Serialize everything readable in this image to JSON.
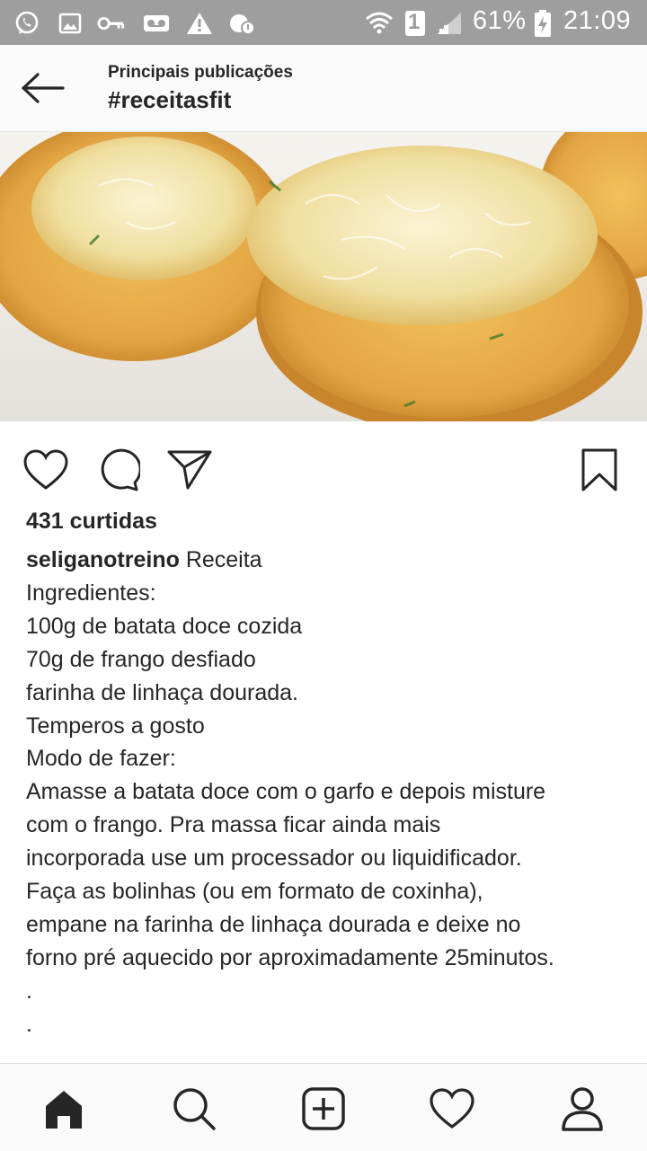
{
  "status_bar": {
    "battery": "61%",
    "time": "21:09",
    "sim_slot": "1",
    "icons": [
      "whatsapp-icon",
      "image-icon",
      "key-icon",
      "voicemail-icon",
      "warning-icon",
      "weather-icon",
      "wifi-icon",
      "sim-icon",
      "signal-icon",
      "battery-charging-icon"
    ]
  },
  "header": {
    "subtitle": "Principais publicações",
    "title": "#receitasfit"
  },
  "post": {
    "likes": "431 curtidas",
    "username": "seliganotreino",
    "caption_first": " Receita",
    "caption_lines": [
      "Ingredientes:",
      "100g de batata doce cozida",
      "70g de frango desfiado",
      "farinha de linhaça dourada.",
      "Temperos a gosto",
      "Modo de fazer:",
      "Amasse a batata doce com o garfo e depois misture",
      "com o frango. Pra massa ficar ainda mais",
      "incorporada use um processador ou liquidificador.",
      "Faça as bolinhas (ou em formato de coxinha),",
      "empane na farinha de linhaça dourada e deixe no",
      "forno pré aquecido por aproximadamente 25minutos.",
      ".",
      "."
    ]
  },
  "bottom_nav": [
    "home-icon",
    "search-icon",
    "add-post-icon",
    "activity-heart-icon",
    "profile-icon"
  ],
  "colors": {
    "status_bar": "#9e9e9e",
    "header_bg": "#fafafa",
    "text": "#262626",
    "croquette": "#e3a543"
  }
}
